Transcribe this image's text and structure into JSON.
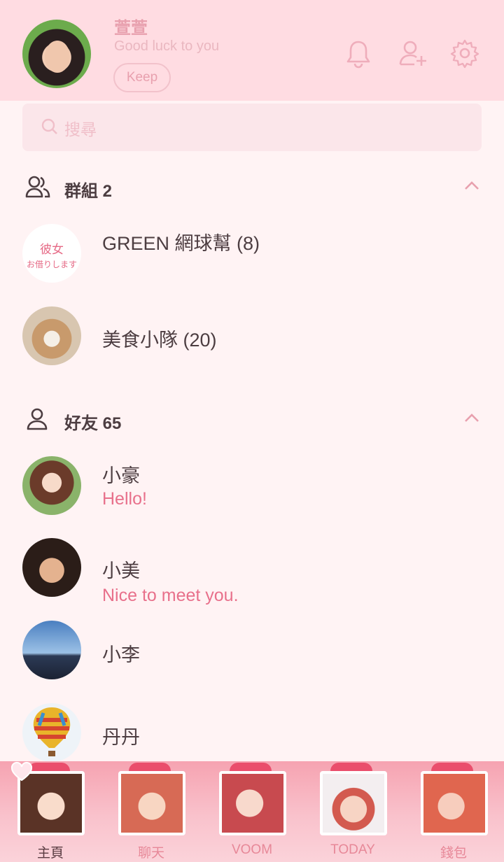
{
  "profile": {
    "name": "萱萱",
    "status": "Good luck to you",
    "keep_label": "Keep"
  },
  "search": {
    "placeholder": "搜尋"
  },
  "groups": {
    "label": "群組 2",
    "items": [
      {
        "name": "GREEN 網球幫 (8)",
        "avatar_text_1": "彼女",
        "avatar_text_2": "お借りします"
      },
      {
        "name": "美食小隊 (20)"
      }
    ]
  },
  "friends": {
    "label": "好友 65",
    "items": [
      {
        "name": "小豪",
        "message": "Hello!"
      },
      {
        "name": "小美",
        "message": "Nice to meet you."
      },
      {
        "name": "小李"
      },
      {
        "name": "丹丹"
      }
    ]
  },
  "tabs": [
    {
      "label": "主頁",
      "active": true
    },
    {
      "label": "聊天"
    },
    {
      "label": "VOOM"
    },
    {
      "label": "TODAY"
    },
    {
      "label": "錢包"
    }
  ],
  "colors": {
    "accent": "#e8708b",
    "header_bg": "#ffdce2",
    "page_bg": "#fff3f4",
    "text": "#4c3d41"
  }
}
